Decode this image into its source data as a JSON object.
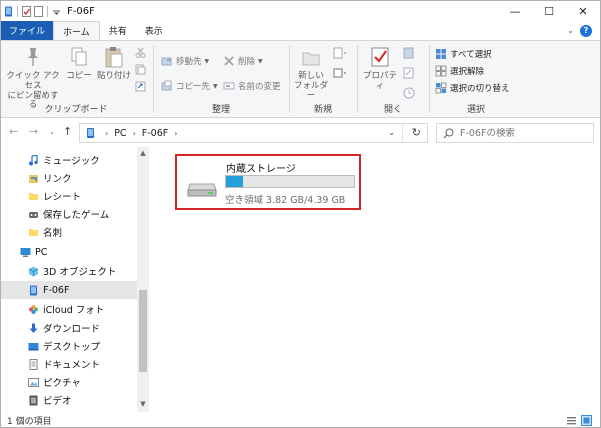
{
  "window": {
    "title": "F-06F",
    "minimize_glyph": "—",
    "maximize_glyph": "☐",
    "close_glyph": "✕"
  },
  "ribbon_tabs": [
    {
      "label": "ファイル"
    },
    {
      "label": "ホーム"
    },
    {
      "label": "共有"
    },
    {
      "label": "表示"
    }
  ],
  "ribbon": {
    "clipboard": {
      "label": "クリップボード",
      "pin_label": "クイック アクセス\nにピン留めする",
      "copy_label": "コピー",
      "paste_label": "貼り付け"
    },
    "organize": {
      "label": "整理",
      "move_to": "移動先",
      "copy_to": "コピー先",
      "delete": "削除",
      "rename": "名前の変更"
    },
    "new": {
      "label": "新規",
      "new_folder": "新しい\nフォルダー"
    },
    "open": {
      "label": "開く",
      "properties": "プロパティ"
    },
    "select": {
      "label": "選択",
      "select_all": "すべて選択",
      "select_none": "選択解除",
      "invert": "選択の切り替え"
    }
  },
  "address": {
    "crumbs": [
      "PC",
      "F-06F"
    ],
    "search_placeholder": "F-06Fの検索"
  },
  "nav_items": [
    {
      "label": "ミュージック",
      "icon": "music-icon"
    },
    {
      "label": "リンク",
      "icon": "link-icon"
    },
    {
      "label": "レシート",
      "icon": "folder-icon"
    },
    {
      "label": "保存したゲーム",
      "icon": "game-icon"
    },
    {
      "label": "名刺",
      "icon": "folder-icon"
    },
    {
      "label": "PC",
      "icon": "pc-icon"
    },
    {
      "label": "3D オブジェクト",
      "icon": "cube-icon"
    },
    {
      "label": "F-06F",
      "icon": "phone-icon",
      "selected": true
    },
    {
      "label": "iCloud フォト",
      "icon": "icloud-photo-icon"
    },
    {
      "label": "ダウンロード",
      "icon": "download-icon"
    },
    {
      "label": "デスクトップ",
      "icon": "desktop-icon"
    },
    {
      "label": "ドキュメント",
      "icon": "document-icon"
    },
    {
      "label": "ピクチャ",
      "icon": "picture-icon"
    },
    {
      "label": "ビデオ",
      "icon": "video-icon"
    }
  ],
  "drive": {
    "name": "内蔵ストレージ",
    "free_text": "空き領域 3.82 GB/4.39 GB",
    "used_fraction": 0.13
  },
  "status": {
    "item_count": "1 個の項目"
  },
  "colors": {
    "file_tab": "#1a5eb3",
    "drive_bar_fill": "#26a0da",
    "highlight_border": "#d42424"
  }
}
